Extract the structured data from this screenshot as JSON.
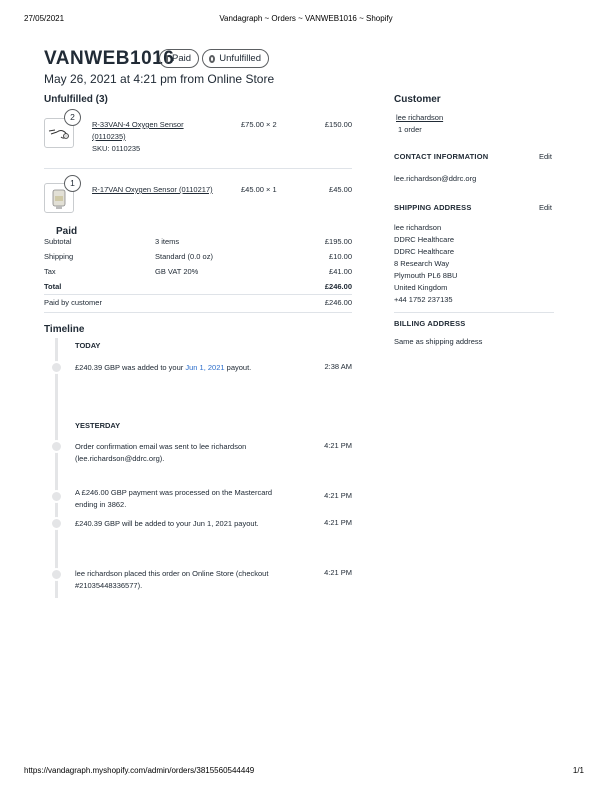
{
  "print": {
    "date": "27/05/2021",
    "title": "Vandagraph ~ Orders ~ VANWEB1016 ~ Shopify",
    "url": "https://vandagraph.myshopify.com/admin/orders/3815560544449",
    "page": "1/1"
  },
  "order": {
    "number": "VANWEB1016",
    "payment_badge": "Paid",
    "fulfillment_badge": "Unfulfilled",
    "subtitle": "May 26, 2021 at 4:21 pm from Online Store"
  },
  "unfulfilled": {
    "heading": "Unfulfilled (3)",
    "items": [
      {
        "quantity": "2",
        "name_line1": "R-33VAN-4 Oxygen Sensor",
        "name_line2": "(0110235)",
        "sku": "SKU: 0110235",
        "unit": "£75.00 × 2",
        "total": "£150.00",
        "icon": "wire-sensor-icon"
      },
      {
        "quantity": "1",
        "name_line1": "R-17VAN Oxygen Sensor (0110217)",
        "unit": "£45.00 × 1",
        "total": "£45.00",
        "icon": "cylinder-sensor-icon"
      }
    ]
  },
  "payment": {
    "heading": "Paid",
    "rows": [
      {
        "label": "Subtotal",
        "detail": "3 items",
        "amount": "£195.00"
      },
      {
        "label": "Shipping",
        "detail": "Standard (0.0 oz)",
        "amount": "£10.00"
      },
      {
        "label": "Tax",
        "detail": "GB VAT 20%",
        "amount": "£41.00"
      }
    ],
    "total_label": "Total",
    "total_amount": "£246.00",
    "paid_label": "Paid by customer",
    "paid_amount": "£246.00"
  },
  "timeline": {
    "heading": "Timeline",
    "today_label": "TODAY",
    "yesterday_label": "YESTERDAY",
    "events": [
      {
        "prefix": "£240.39 GBP was added to your ",
        "link": "Jun 1, 2021",
        "suffix": " payout.",
        "time": "2:38 AM"
      },
      {
        "line1": "Order confirmation email was sent to lee richardson",
        "line2": "(lee.richardson@ddrc.org).",
        "time": "4:21 PM"
      },
      {
        "line1": "A £246.00 GBP payment was processed on the Mastercard",
        "line2": "ending in 3862.",
        "time": "4:21 PM"
      },
      {
        "line1": "£240.39 GBP will be added to your Jun 1, 2021 payout.",
        "time": "4:21 PM"
      },
      {
        "line1": "lee richardson placed this order on Online Store (checkout",
        "line2": "#21035448336577).",
        "time": "4:21 PM"
      }
    ]
  },
  "customer": {
    "heading": "Customer",
    "name": "lee richardson",
    "orders": "1 order",
    "contact_heading": "CONTACT INFORMATION",
    "edit_label": "Edit",
    "email": "lee.richardson@ddrc.org",
    "shipping_heading": "SHIPPING ADDRESS",
    "shipping_lines": [
      "lee richardson",
      "DDRC Healthcare",
      "DDRC Healthcare",
      "8 Research Way",
      "Plymouth PL6 8BU",
      "United Kingdom",
      "+44 1752 237135"
    ],
    "billing_heading": "BILLING ADDRESS",
    "billing_text": "Same as shipping address"
  }
}
